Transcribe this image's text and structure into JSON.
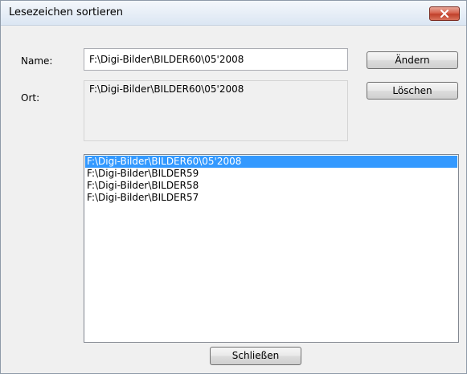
{
  "window": {
    "title": "Lesezeichen sortieren"
  },
  "form": {
    "name_label": "Name:",
    "name_value": "F:\\Digi-Bilder\\BILDER60\\05'2008",
    "ort_label": "Ort:",
    "ort_value": "F:\\Digi-Bilder\\BILDER60\\05'2008"
  },
  "buttons": {
    "change_label": "Ändern",
    "delete_label": "Löschen",
    "close_label": "Schließen"
  },
  "bookmarks": {
    "selected_index": 0,
    "items": [
      "F:\\Digi-Bilder\\BILDER60\\05'2008",
      "F:\\Digi-Bilder\\BILDER59",
      "F:\\Digi-Bilder\\BILDER58",
      "F:\\Digi-Bilder\\BILDER57"
    ]
  },
  "colors": {
    "selection": "#3399ff",
    "close_button": "#c75050"
  },
  "icons": {
    "close": "close-icon"
  }
}
